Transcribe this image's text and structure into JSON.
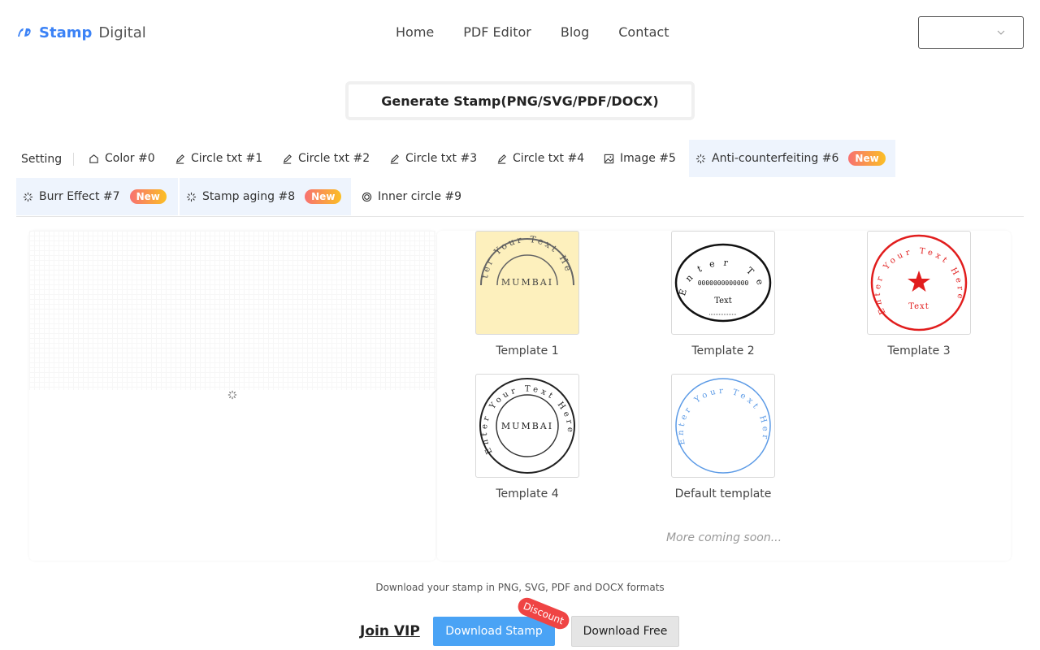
{
  "brand": {
    "name": "Stamp",
    "suffix": "Digital",
    "color": "#3b82f6"
  },
  "nav": [
    "Home",
    "PDF Editor",
    "Blog",
    "Contact"
  ],
  "language_select": {
    "value": ""
  },
  "generate_title": "Generate Stamp(PNG/SVG/PDF/DOCX)",
  "tabs": {
    "setting_label": "Setting",
    "items": [
      {
        "label": "Color #0",
        "icon": "home-icon"
      },
      {
        "label": "Circle txt #1",
        "icon": "pen-icon"
      },
      {
        "label": "Circle txt #2",
        "icon": "pen-icon"
      },
      {
        "label": "Circle txt #3",
        "icon": "pen-icon"
      },
      {
        "label": "Circle txt #4",
        "icon": "pen-icon"
      },
      {
        "label": "Image #5",
        "icon": "image-icon"
      },
      {
        "label": "Anti-counterfeiting #6",
        "icon": "loading-icon",
        "badge": "New",
        "active": true
      },
      {
        "label": "Burr Effect #7",
        "icon": "loading-icon",
        "badge": "New",
        "active": true
      },
      {
        "label": "Stamp aging #8",
        "icon": "loading-icon",
        "badge": "New",
        "active": true
      },
      {
        "label": "Inner circle #9",
        "icon": "circle-icon"
      }
    ]
  },
  "templates": [
    {
      "caption": "Template 1",
      "arc_text": "ter Your Text He",
      "center_text": "MUMBAI"
    },
    {
      "caption": "Template 2",
      "arc_text": "Enter Text",
      "center_text": "0000000000000",
      "sub_text": "Text"
    },
    {
      "caption": "Template 3",
      "arc_text": "Enter Your Text Here",
      "center_text": "Text"
    },
    {
      "caption": "Template 4",
      "arc_text": "Enter Your Text Here",
      "center_text": "MUMBAI"
    },
    {
      "caption": "Default template",
      "arc_text": "Enter Your Text Here"
    }
  ],
  "more_coming": "More coming soon...",
  "formats_text": "Download your stamp in PNG, SVG, PDF and DOCX formats",
  "actions": {
    "vip": "Join VIP",
    "download": "Download Stamp",
    "discount": "Discount",
    "free": "Download Free"
  },
  "colors": {
    "accent": "#4aa3f5",
    "badge_start": "#f87171",
    "badge_end": "#fbbf24",
    "stamp_red": "#e11d1d",
    "stamp_blue": "#5b9ae6"
  }
}
